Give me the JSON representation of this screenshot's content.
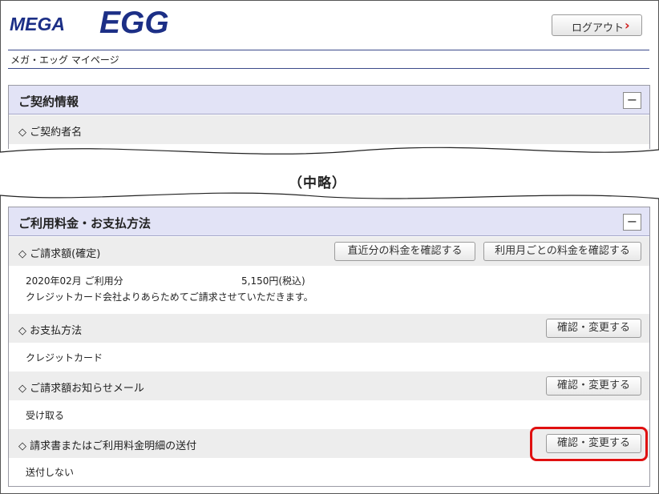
{
  "header": {
    "logo_mega": "MEGA",
    "logo_egg": "EGG",
    "logout_label": "ログアウト",
    "page_title": "メガ・エッグ マイページ"
  },
  "contract": {
    "title": "ご契約情報",
    "collapse_glyph": "−",
    "row1_label": "◇ ご契約者名"
  },
  "omitted_label": "（中略）",
  "billing": {
    "title": "ご利用料金・お支払方法",
    "collapse_glyph": "−",
    "rows": [
      {
        "label": "◇ ご請求額(確定)",
        "buttons": [
          "直近分の料金を確認する",
          "利用月ごとの料金を確認する"
        ],
        "period": "2020年02月 ご利用分",
        "amount": "5,150円(税込)",
        "note": "クレジットカード会社よりあらためてご請求させていただきます。"
      },
      {
        "label": "◇ お支払方法",
        "button": "確認・変更する",
        "value": "クレジットカード"
      },
      {
        "label": "◇ ご請求額お知らせメール",
        "button": "確認・変更する",
        "value": "受け取る"
      },
      {
        "label": "◇ 請求書またはご利用料金明細の送付",
        "button": "確認・変更する",
        "value": "送付しない"
      }
    ]
  },
  "colors": {
    "brand_blue": "#1c2f86",
    "panel_header": "#e2e3f6",
    "row_grey": "#ededed",
    "highlight_red": "#e01010",
    "logout_chevron": "#d01c1c"
  },
  "icons": {
    "logout": "chevron-right-icon",
    "collapse": "minus-icon"
  }
}
